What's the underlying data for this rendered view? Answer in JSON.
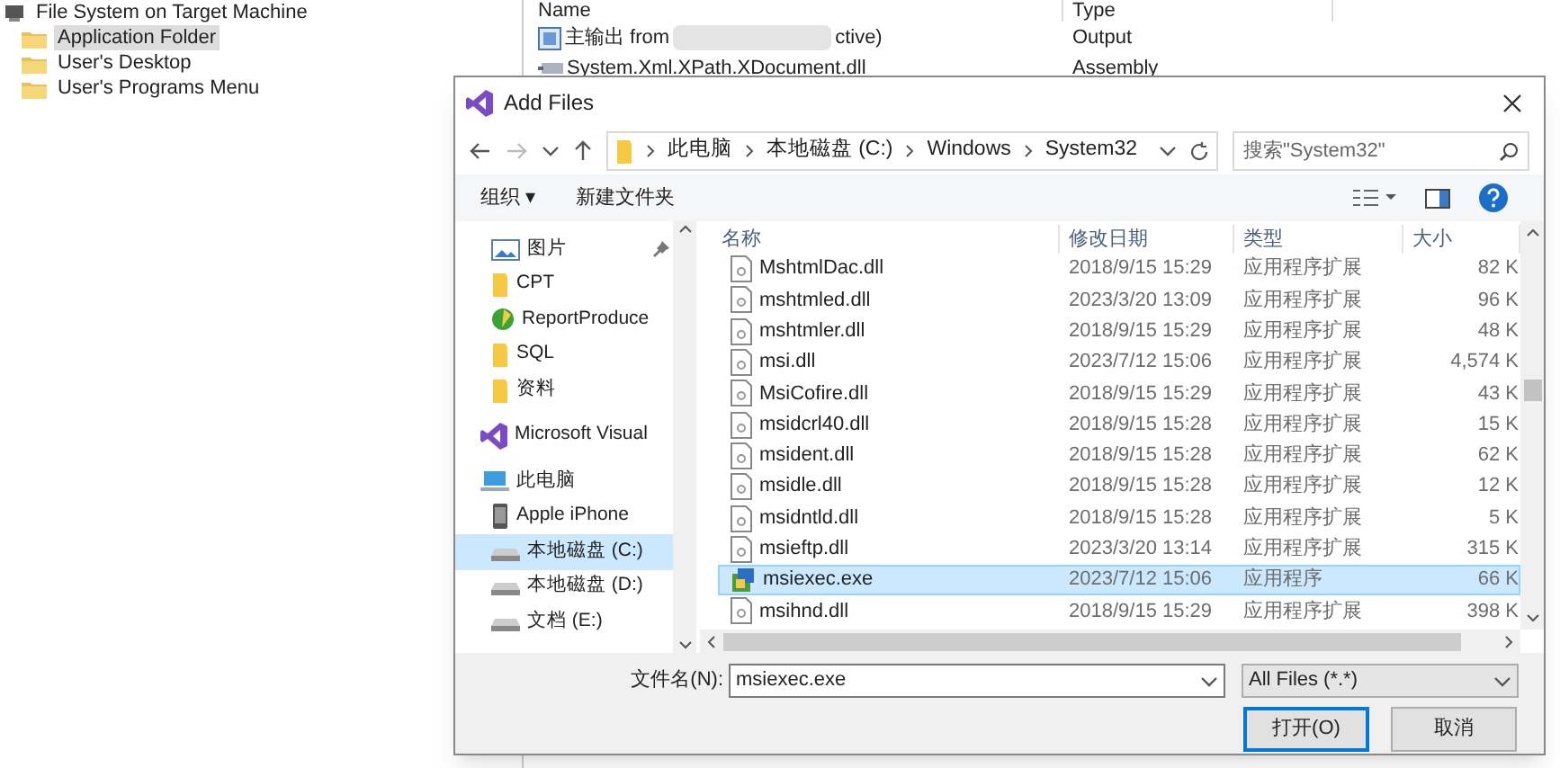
{
  "background": {
    "tree": [
      {
        "label": "File System on Target Machine",
        "kind": "root",
        "selected": false
      },
      {
        "label": "Application Folder",
        "kind": "folder",
        "selected": true
      },
      {
        "label": "User's Desktop",
        "kind": "folder",
        "selected": false
      },
      {
        "label": "User's Programs Menu",
        "kind": "folder",
        "selected": false
      }
    ],
    "columns": [
      "Name",
      "Type"
    ],
    "rows": [
      {
        "name": "主输出 from",
        "name_tail": "ctive)",
        "type": "Output",
        "kind": "output"
      },
      {
        "name": "System.Xml.XPath.XDocument.dll",
        "type": "Assembly",
        "kind": "assembly"
      }
    ]
  },
  "dialog": {
    "title": "Add Files",
    "breadcrumb": [
      "此电脑",
      "本地磁盘 (C:)",
      "Windows",
      "System32"
    ],
    "search": {
      "placeholder": "搜索\"System32\""
    },
    "toolbar": [
      "组织 ▾",
      "新建文件夹"
    ],
    "nav": [
      {
        "label": "图片",
        "kind": "pictures",
        "pinned": true,
        "selected": false
      },
      {
        "label": "CPT",
        "kind": "folder",
        "pinned": false,
        "selected": false
      },
      {
        "label": "ReportProduce",
        "kind": "app",
        "pinned": false,
        "selected": false
      },
      {
        "label": "SQL",
        "kind": "folder",
        "pinned": false,
        "selected": false
      },
      {
        "label": "资料",
        "kind": "folder",
        "pinned": false,
        "selected": false
      },
      {
        "label": "Microsoft Visual",
        "kind": "vs",
        "pinned": false,
        "selected": false
      },
      {
        "label": "此电脑",
        "kind": "pc",
        "pinned": false,
        "selected": false
      },
      {
        "label": "Apple iPhone",
        "kind": "phone",
        "pinned": false,
        "selected": false
      },
      {
        "label": "本地磁盘 (C:)",
        "kind": "drive",
        "pinned": false,
        "selected": true
      },
      {
        "label": "本地磁盘 (D:)",
        "kind": "drive",
        "pinned": false,
        "selected": false
      },
      {
        "label": "文档 (E:)",
        "kind": "drive",
        "pinned": false,
        "selected": false
      }
    ],
    "columns": [
      "名称",
      "修改日期",
      "类型",
      "大小"
    ],
    "files": [
      {
        "name": "MshtmlDac.dll",
        "date": "2018/9/15 15:29",
        "type": "应用程序扩展",
        "size": "82 K",
        "kind": "dll",
        "selected": false
      },
      {
        "name": "mshtmled.dll",
        "date": "2023/3/20 13:09",
        "type": "应用程序扩展",
        "size": "96 K",
        "kind": "dll",
        "selected": false
      },
      {
        "name": "mshtmler.dll",
        "date": "2018/9/15 15:29",
        "type": "应用程序扩展",
        "size": "48 K",
        "kind": "dll",
        "selected": false
      },
      {
        "name": "msi.dll",
        "date": "2023/7/12 15:06",
        "type": "应用程序扩展",
        "size": "4,574 K",
        "kind": "dll",
        "selected": false
      },
      {
        "name": "MsiCofire.dll",
        "date": "2018/9/15 15:29",
        "type": "应用程序扩展",
        "size": "43 K",
        "kind": "dll",
        "selected": false
      },
      {
        "name": "msidcrl40.dll",
        "date": "2018/9/15 15:28",
        "type": "应用程序扩展",
        "size": "15 K",
        "kind": "dll",
        "selected": false
      },
      {
        "name": "msident.dll",
        "date": "2018/9/15 15:28",
        "type": "应用程序扩展",
        "size": "62 K",
        "kind": "dll",
        "selected": false
      },
      {
        "name": "msidle.dll",
        "date": "2018/9/15 15:28",
        "type": "应用程序扩展",
        "size": "12 K",
        "kind": "dll",
        "selected": false
      },
      {
        "name": "msidntld.dll",
        "date": "2018/9/15 15:28",
        "type": "应用程序扩展",
        "size": "5 K",
        "kind": "dll",
        "selected": false
      },
      {
        "name": "msieftp.dll",
        "date": "2023/3/20 13:14",
        "type": "应用程序扩展",
        "size": "315 K",
        "kind": "dll",
        "selected": false
      },
      {
        "name": "msiexec.exe",
        "date": "2023/7/12 15:06",
        "type": "应用程序",
        "size": "66 K",
        "kind": "exe",
        "selected": true
      },
      {
        "name": "msihnd.dll",
        "date": "2018/9/15 15:29",
        "type": "应用程序扩展",
        "size": "398 K",
        "kind": "dll",
        "selected": false
      }
    ],
    "filename_label": "文件名(N):",
    "filename": "msiexec.exe",
    "filter": "All Files (*.*)",
    "buttons": [
      "打开(O)",
      "取消"
    ]
  }
}
